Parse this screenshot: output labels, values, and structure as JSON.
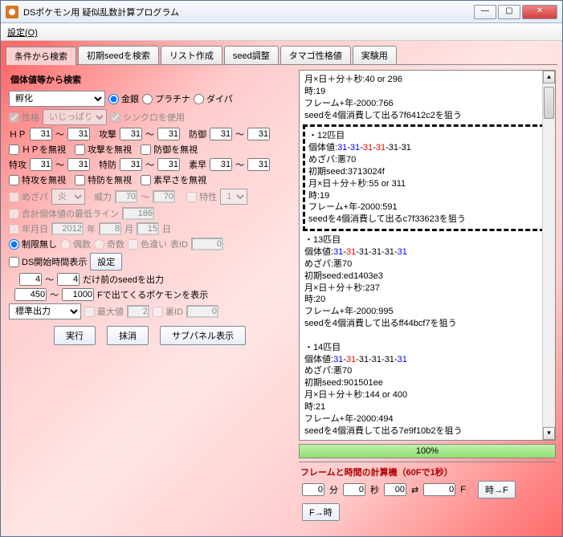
{
  "window": {
    "title": "DSポケモン用 疑似乱数計算プログラム"
  },
  "menu": {
    "settings": "設定(O)"
  },
  "tabs": [
    "条件から検索",
    "初期seedを検索",
    "リスト作成",
    "seed調整",
    "タマゴ性格値",
    "実験用"
  ],
  "left": {
    "sectionTitle": "個体値等から検索",
    "method": "孵化",
    "ver": {
      "gs": "金銀",
      "pt": "プラチナ",
      "dp": "ダイパ"
    },
    "nature": {
      "lbl": "性格",
      "val": "いじっぱり",
      "sync": "シンクロを使用"
    },
    "stats": {
      "hp": "ＨＰ",
      "atk": "攻撃",
      "def": "防御",
      "spa": "特攻",
      "spd": "特防",
      "spe": "素早",
      "v31": "31",
      "to": "～"
    },
    "ignore": {
      "hp": "ＨＰを無視",
      "atk": "攻撃を無視",
      "def": "防御を無視",
      "spa": "特攻を無視",
      "spd": "特防を無視",
      "spe": "素早さを無視"
    },
    "hidden": {
      "lbl": "めざパ",
      "type": "炎",
      "pow": "威力",
      "v70": "70",
      "abil": "特性",
      "v1": "1"
    },
    "ivsum": {
      "lbl": "合計個体値の最低ライン",
      "v": "186"
    },
    "date": {
      "lbl": "年月日",
      "y": "2012",
      "yl": "年",
      "m": "8",
      "ml": "月",
      "d": "15",
      "dl": "日"
    },
    "limit": {
      "none": "制限無し",
      "even": "偶数",
      "odd": "奇数",
      "shiny": "色違い",
      "tid": "表ID",
      "tidv": "0"
    },
    "dsstart": {
      "lbl": "DS開始時間表示",
      "btn": "設定"
    },
    "seedrange": {
      "a": "4",
      "b": "4",
      "txt": "だけ前のseedを出力"
    },
    "frange": {
      "a": "450",
      "b": "1000",
      "txt": "Fで出てくるポケモンを表示"
    },
    "out": {
      "sel": "標準出力",
      "max": "最大値",
      "maxv": "2",
      "sid": "裏ID",
      "sidv": "0"
    },
    "btns": {
      "run": "実行",
      "clear": "抹消",
      "sub": "サブパネル表示"
    }
  },
  "output": {
    "top": [
      "月×日＋分＋秒:40 or 296",
      "時:19",
      "フレーム+年-2000:766",
      "seedを4個消費して出る7f6412c2を狙う"
    ],
    "b12": {
      "h": "・12匹目",
      "iv": [
        "個体値:",
        "31",
        "-",
        "31",
        "-",
        "31",
        "-",
        "31",
        "-31-31"
      ],
      "hp": "めざパ:悪70",
      "seed": "初期seed:3713024f",
      "t1": "月×日＋分＋秒:55 or 311",
      "t2": "時:19",
      "t3": "フレーム+年-2000:591",
      "tgt": "seedを4個消費して出るc7f33623を狙う"
    },
    "b13": {
      "h": "・13匹目",
      "iv": [
        "個体値:",
        "31",
        "-",
        "31",
        "-31-31-31-",
        "31"
      ],
      "hp": "めざパ:悪70",
      "seed": "初期seed:ed1403e3",
      "t1": "月×日＋分＋秒:237",
      "t2": "時:20",
      "t3": "フレーム+年-2000:995",
      "tgt": "seedを4個消費して出るff44bcf7を狙う"
    },
    "b14": {
      "h": "・14匹目",
      "iv": [
        "個体値:",
        "31",
        "-",
        "31",
        "-31-31-31-",
        "31"
      ],
      "hp": "めざパ:悪70",
      "seed": "初期seed:901501ee",
      "t1": "月×日＋分＋秒:144 or 400",
      "t2": "時:21",
      "t3": "フレーム+年-2000:494",
      "tgt": "seedを4個消費して出る7e9f10b2を狙う"
    }
  },
  "progress": "100%",
  "footer": {
    "title": "フレームと時間の計算機（60Fで1秒）",
    "min": "0",
    "minl": "分",
    "sec": "0",
    "secl": "秒",
    "fps": "00",
    "arrow": "⇄",
    "fval": "0",
    "fl": "F",
    "btn1": "時→F",
    "btn2": "F→時"
  }
}
